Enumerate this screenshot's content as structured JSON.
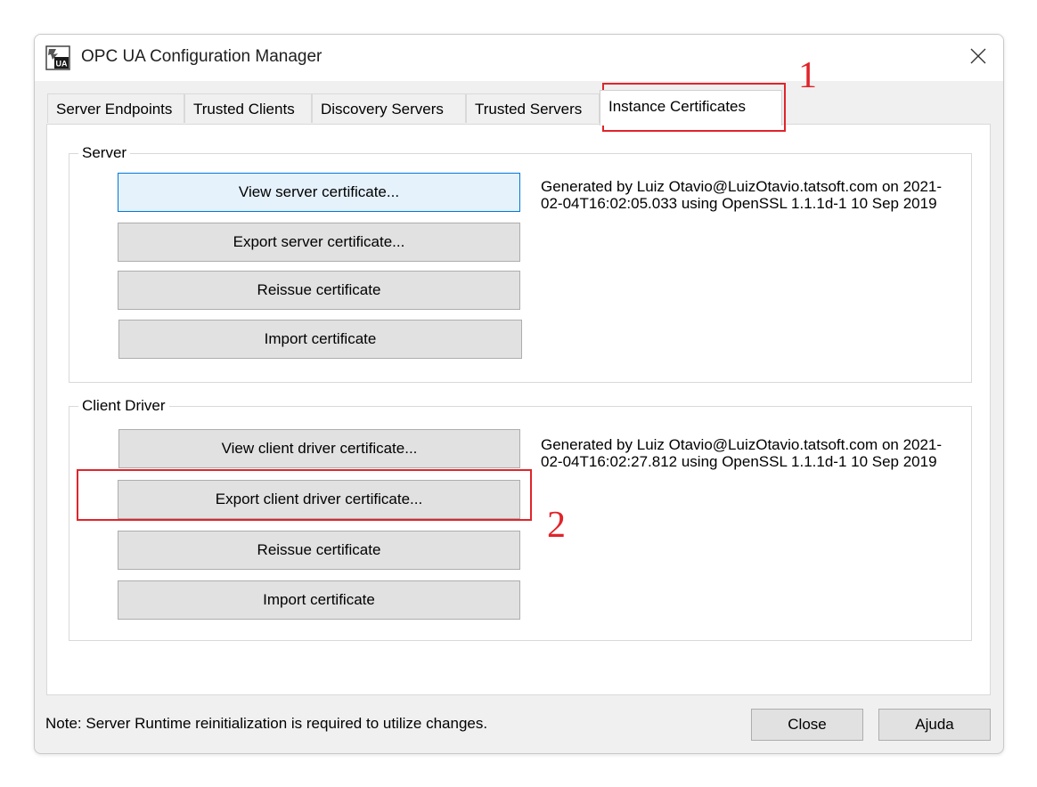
{
  "window": {
    "title": "OPC UA Configuration Manager",
    "icon": "opc-ua-app-icon"
  },
  "tabs": [
    {
      "label": "Server Endpoints"
    },
    {
      "label": "Trusted Clients"
    },
    {
      "label": "Discovery Servers"
    },
    {
      "label": "Trusted Servers"
    },
    {
      "label": "Instance Certificates",
      "active": true
    }
  ],
  "server": {
    "group_label": "Server",
    "buttons": {
      "view": "View server certificate...",
      "export": "Export server certificate...",
      "reissue": "Reissue certificate",
      "import": "Import certificate"
    },
    "info": "Generated by Luiz Otavio@LuizOtavio.tatsoft.com on 2021-02-04T16:02:05.033 using OpenSSL 1.1.1d-1  10 Sep 2019"
  },
  "client_driver": {
    "group_label": "Client Driver",
    "buttons": {
      "view": "View client driver certificate...",
      "export": "Export client driver certificate...",
      "reissue": "Reissue certificate",
      "import": "Import certificate"
    },
    "info": "Generated by Luiz Otavio@LuizOtavio.tatsoft.com on 2021-02-04T16:02:27.812 using OpenSSL 1.1.1d-1  10 Sep 2019"
  },
  "footer": {
    "note": "Note: Server Runtime reinitialization is required to utilize changes.",
    "close_label": "Close",
    "help_label": "Ajuda"
  },
  "annotations": {
    "step1": "1",
    "step2": "2",
    "color": "#e0242b"
  }
}
